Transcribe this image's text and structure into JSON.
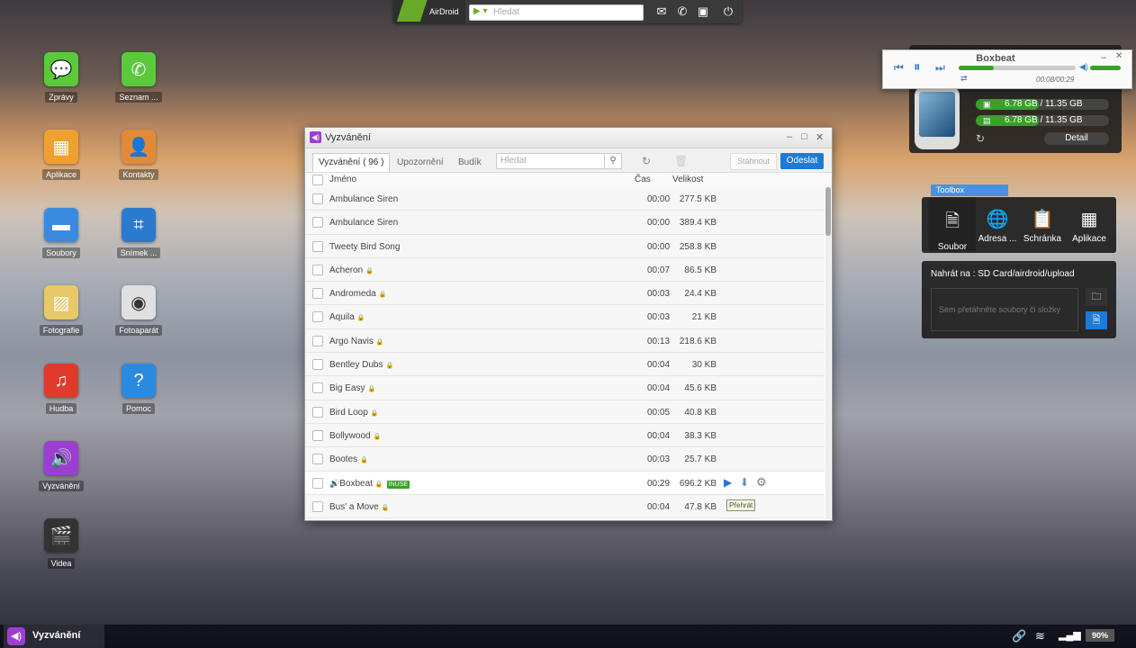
{
  "topbar": {
    "brand": "AirDroid",
    "search_placeholder": "Hledat",
    "icons": [
      "mail-icon",
      "phone-icon",
      "screen-icon",
      "power-icon"
    ]
  },
  "desktop_icons": [
    {
      "label": "Zprávy",
      "icon": "chat-bubble",
      "color": "#5cc93d"
    },
    {
      "label": "Seznam ...",
      "icon": "phone",
      "color": "#5cc93d"
    },
    {
      "label": "Aplikace",
      "icon": "box",
      "color": "#f0a030"
    },
    {
      "label": "Kontakty",
      "icon": "contact-book",
      "color": "#e08a3a"
    },
    {
      "label": "Soubory",
      "icon": "folder",
      "color": "#3a8ae0"
    },
    {
      "label": "Snímek ...",
      "icon": "crop",
      "color": "#2a7ad0"
    },
    {
      "label": "Fotografie",
      "icon": "photo",
      "color": "#e8c86a"
    },
    {
      "label": "Fotoaparát",
      "icon": "camera",
      "color": "#e0e0e0"
    },
    {
      "label": "Hudba",
      "icon": "music-note",
      "color": "#e03a2a"
    },
    {
      "label": "Pomoc",
      "icon": "question",
      "color": "#2a8ae0"
    },
    {
      "label": "Vyzvánění",
      "icon": "speaker",
      "color": "#9b3fd0"
    },
    {
      "label": "Videa",
      "icon": "clapper",
      "color": "#333333"
    }
  ],
  "window": {
    "title": "Vyzvánění",
    "tabs": [
      "Vyzvánění ( 96 )",
      "Upozornění",
      "Budík"
    ],
    "search_placeholder": "Hledat",
    "btn_download": "Stáhnout",
    "btn_send": "Odeslat",
    "columns": {
      "name": "Jméno",
      "time": "Čas",
      "size": "Velikost"
    },
    "rows": [
      {
        "name": "Ambulance Siren",
        "time": "00:00",
        "size": "277.5 KB",
        "lock": false
      },
      {
        "name": "Ambulance Siren",
        "time": "00:00",
        "size": "389.4 KB",
        "lock": false
      },
      {
        "name": "Tweety Bird Song",
        "time": "00:00",
        "size": "258.8 KB",
        "lock": false
      },
      {
        "name": "Acheron",
        "time": "00:07",
        "size": "86.5 KB",
        "lock": true
      },
      {
        "name": "Andromeda",
        "time": "00:03",
        "size": "24.4 KB",
        "lock": true
      },
      {
        "name": "Aquila",
        "time": "00:03",
        "size": "21 KB",
        "lock": true
      },
      {
        "name": "Argo Navis",
        "time": "00:13",
        "size": "218.6 KB",
        "lock": true
      },
      {
        "name": "Bentley Dubs",
        "time": "00:04",
        "size": "30 KB",
        "lock": true
      },
      {
        "name": "Big Easy",
        "time": "00:04",
        "size": "45.6 KB",
        "lock": true
      },
      {
        "name": "Bird Loop",
        "time": "00:05",
        "size": "40.8 KB",
        "lock": true
      },
      {
        "name": "Bollywood",
        "time": "00:04",
        "size": "38.3 KB",
        "lock": true
      },
      {
        "name": "Bootes",
        "time": "00:03",
        "size": "25.7 KB",
        "lock": true
      },
      {
        "name": "Boxbeat",
        "time": "00:29",
        "size": "696.2 KB",
        "lock": true,
        "inuse": "INUSE"
      },
      {
        "name": "Bus' a Move",
        "time": "00:04",
        "size": "47.8 KB",
        "lock": true
      }
    ],
    "tooltip": "Přehrát"
  },
  "player": {
    "title": "Boxbeat",
    "time": "00:08/00:29"
  },
  "device": {
    "storage1": "6.78 GB / 11.35 GB",
    "storage2": "6.78 GB / 11.35 GB",
    "detail": "Detail"
  },
  "toolbox": {
    "tag": "Toolbox",
    "items": [
      "Soubor",
      "Adresa ...",
      "Schránka",
      "Aplikace"
    ]
  },
  "upload": {
    "header": "Nahrát na : SD Card/airdroid/upload",
    "drop_hint": "Sem přetáhněte soubory či složky"
  },
  "taskbar": {
    "active": "Vyzvánění",
    "battery": "90%"
  }
}
